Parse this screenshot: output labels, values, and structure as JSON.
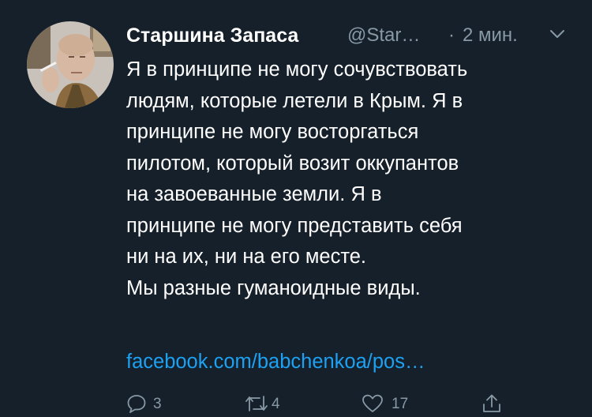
{
  "tweet": {
    "display_name": "Старшина Запаса",
    "handle": "@Star…",
    "separator": "·",
    "time": "2 мин.",
    "text_lines": [
      "Я в принципе не могу сочувствовать",
      "людям, которые летели в Крым. Я в",
      "принципе не могу восторгаться",
      "пилотом, который возит оккупантов",
      "на завоеванные земли. Я в",
      "принципе не могу представить себя",
      "ни на их, ни на его месте.",
      "Мы разные гуманоидные виды."
    ],
    "link_text": "facebook.com/babchenkoa/pos…"
  },
  "actions": {
    "reply_count": "3",
    "retweet_count": "4",
    "like_count": "17"
  },
  "icons": {
    "menu": "chevron-down-icon",
    "reply": "reply-icon",
    "retweet": "retweet-icon",
    "like": "heart-icon",
    "share": "share-icon"
  },
  "colors": {
    "background": "#15202b",
    "text": "#ffffff",
    "secondary": "#8899a6",
    "link": "#1da1f2"
  }
}
